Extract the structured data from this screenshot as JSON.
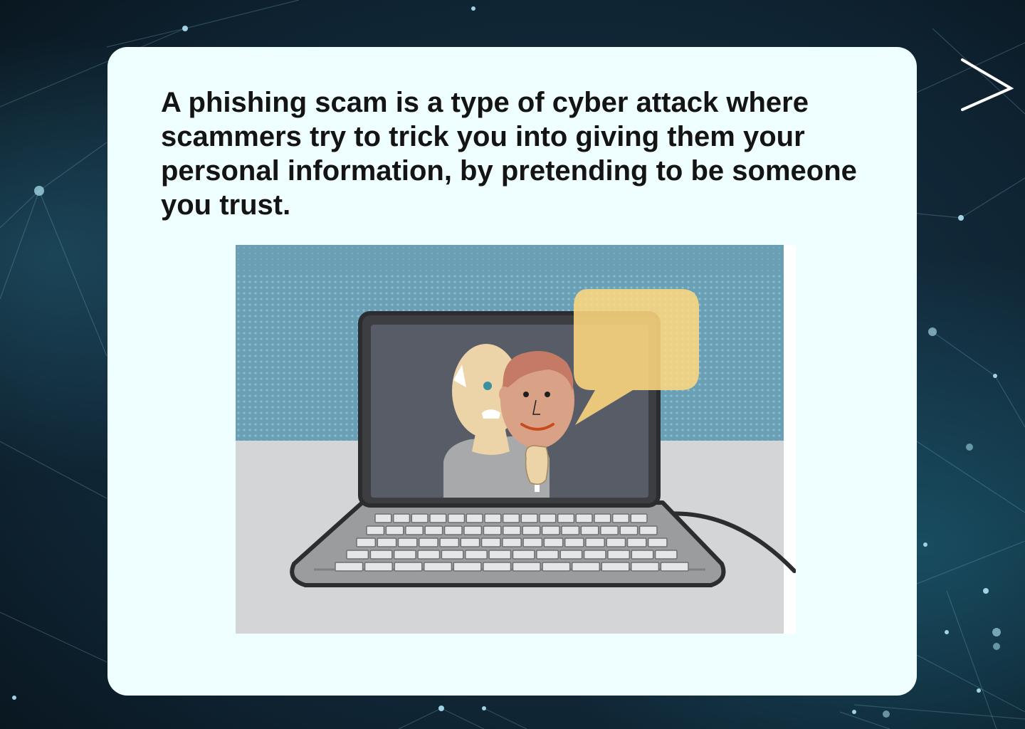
{
  "slide": {
    "body_text": "A phishing scam is a type of cyber attack where\nscammers try to trick you into giving them your\npersonal information,  by pretending to be someone\nyou trust."
  },
  "navigation": {
    "next_icon": "chevron-right-icon"
  },
  "illustration": {
    "subject": "laptop-with-masked-scammer",
    "colors": {
      "wall": "#6aa0b6",
      "desk": "#d3d5d6",
      "screen": "#585c66",
      "laptop_body": "#9a9c9d",
      "speech_bubble": "#fdd77f",
      "mask_face": "#d9a185",
      "mask_hair": "#c57a65",
      "scammer_head": "#ecd3a8",
      "scammer_shirt": "#a7a9aa"
    }
  },
  "theme": {
    "card_background": "#effefe",
    "text_color": "#141414",
    "page_background": "#0b1a24"
  }
}
